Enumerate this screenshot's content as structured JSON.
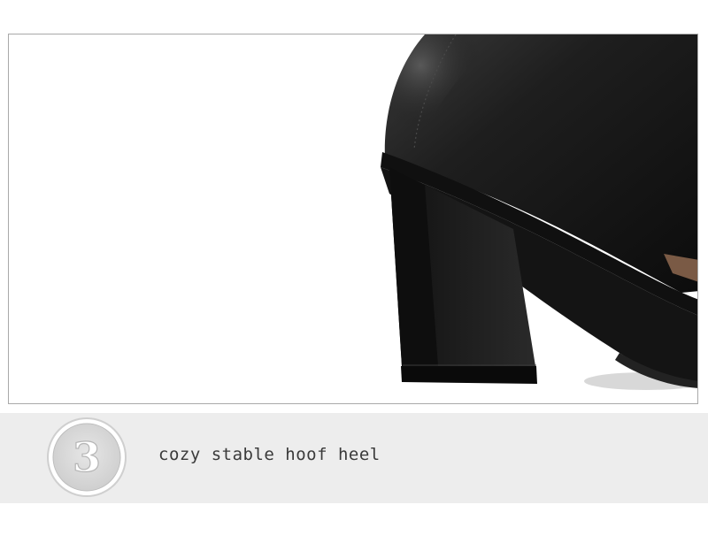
{
  "feature": {
    "number": "3",
    "caption": "cozy stable hoof heel"
  },
  "product": {
    "image_subject": "black-leather-block-heel-pump-icon"
  },
  "colors": {
    "band": "#ededed",
    "frame_border": "#a9a9a9",
    "caption_text": "#3a3a3a",
    "badge_number": "#ffffff",
    "leather": "#1b1b1b"
  }
}
